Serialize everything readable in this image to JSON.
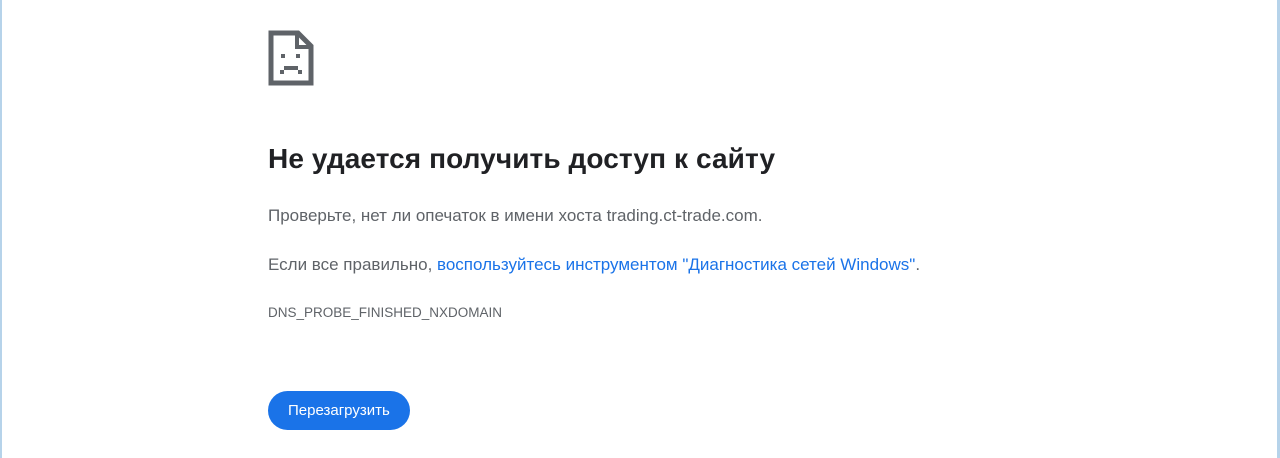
{
  "error": {
    "title": "Не удается получить доступ к сайту",
    "line1": "Проверьте, нет ли опечаток в имени хоста trading.ct-trade.com.",
    "line2_prefix": "Если все правильно, ",
    "line2_link": "воспользуйтесь инструментом \"Диагностика сетей Windows\"",
    "line2_suffix": ".",
    "code": "DNS_PROBE_FINISHED_NXDOMAIN",
    "reload_label": "Перезагрузить"
  },
  "colors": {
    "accent": "#1a73e8",
    "title": "#202124",
    "text": "#5f6368",
    "frame_border": "#b6d3ea"
  },
  "icons": {
    "error_icon": "sad-page-icon"
  }
}
